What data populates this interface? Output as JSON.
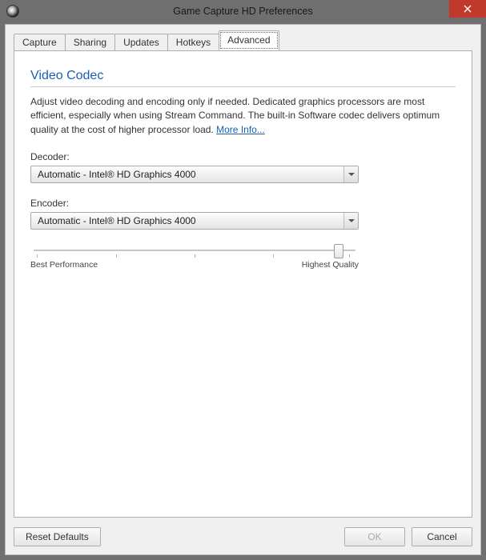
{
  "window": {
    "title": "Game Capture HD Preferences"
  },
  "tabs": {
    "items": [
      {
        "label": "Capture"
      },
      {
        "label": "Sharing"
      },
      {
        "label": "Updates"
      },
      {
        "label": "Hotkeys"
      },
      {
        "label": "Advanced"
      }
    ],
    "active_index": 4
  },
  "section": {
    "title": "Video Codec",
    "description": "Adjust video decoding and encoding only if needed. Dedicated graphics processors are most efficient, especially when using Stream Command. The built-in Software codec delivers optimum quality at the cost of higher processor load. ",
    "more_info_label": "More Info..."
  },
  "decoder": {
    "label": "Decoder:",
    "value": "Automatic - Intel® HD Graphics 4000"
  },
  "encoder": {
    "label": "Encoder:",
    "value": "Automatic - Intel® HD Graphics 4000"
  },
  "slider": {
    "left_label": "Best Performance",
    "right_label": "Highest Quality",
    "value_percent": 94,
    "ticks": 5
  },
  "buttons": {
    "reset": "Reset Defaults",
    "ok": "OK",
    "cancel": "Cancel"
  }
}
